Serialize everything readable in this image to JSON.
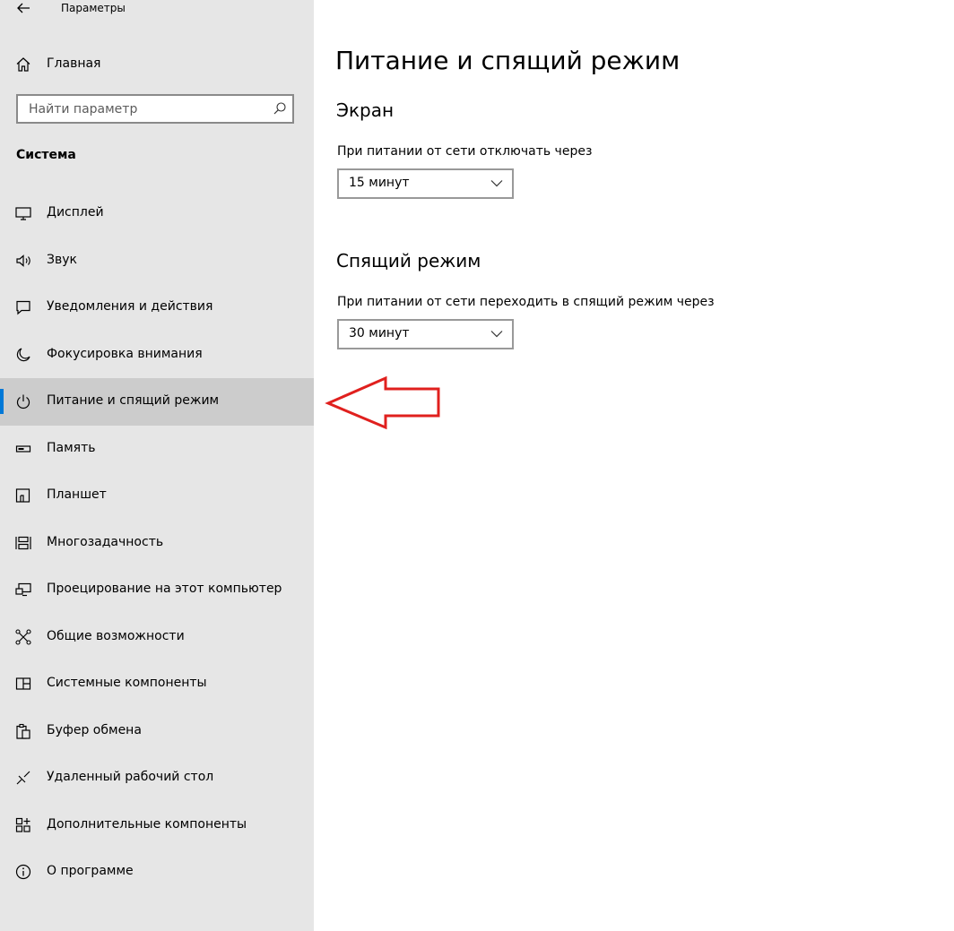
{
  "app": {
    "title": "Параметры"
  },
  "sidebar": {
    "home_label": "Главная",
    "search": {
      "placeholder": "Найти параметр",
      "value": ""
    },
    "section_title": "Система",
    "items": [
      {
        "label": "Дисплей",
        "icon": "monitor-icon"
      },
      {
        "label": "Звук",
        "icon": "speaker-icon"
      },
      {
        "label": "Уведомления и действия",
        "icon": "notification-icon"
      },
      {
        "label": "Фокусировка внимания",
        "icon": "moon-icon"
      },
      {
        "label": "Питание и спящий режим",
        "icon": "power-icon",
        "active": true
      },
      {
        "label": "Память",
        "icon": "storage-icon"
      },
      {
        "label": "Планшет",
        "icon": "tablet-icon"
      },
      {
        "label": "Многозадачность",
        "icon": "multitasking-icon"
      },
      {
        "label": "Проецирование на этот компьютер",
        "icon": "projecting-icon"
      },
      {
        "label": "Общие возможности",
        "icon": "shared-experiences-icon"
      },
      {
        "label": "Системные компоненты",
        "icon": "system-components-icon"
      },
      {
        "label": "Буфер обмена",
        "icon": "clipboard-icon"
      },
      {
        "label": "Удаленный рабочий стол",
        "icon": "remote-desktop-icon"
      },
      {
        "label": "Дополнительные компоненты",
        "icon": "optional-features-icon"
      },
      {
        "label": "О программе",
        "icon": "info-icon"
      }
    ]
  },
  "main": {
    "title": "Питание и спящий режим",
    "screen": {
      "heading": "Экран",
      "label": "При питании от сети отключать через",
      "value": "15 минут"
    },
    "sleep": {
      "heading": "Спящий режим",
      "label": "При питании от сети переходить в спящий режим через",
      "value": "30 минут"
    }
  },
  "colors": {
    "sidebar_bg": "#e6e6e6",
    "active_item_bg": "#cccccc",
    "accent": "#0078d7",
    "annotation_arrow": "#e0201e"
  }
}
